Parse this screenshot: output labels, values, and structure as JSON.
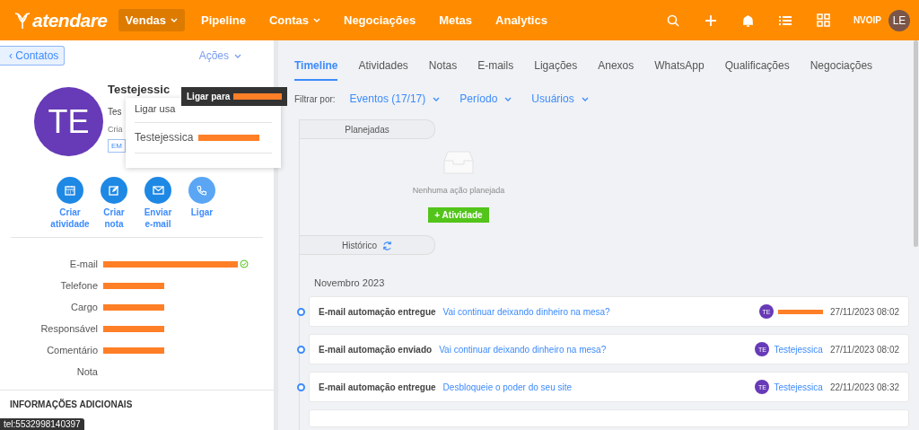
{
  "topbar": {
    "logo": "atendare",
    "nav": [
      {
        "label": "Vendas",
        "selected": true,
        "has_menu": true
      },
      {
        "label": "Pipeline",
        "selected": false,
        "has_menu": false
      },
      {
        "label": "Contas",
        "selected": false,
        "has_menu": true
      },
      {
        "label": "Negociações",
        "selected": false,
        "has_menu": false
      },
      {
        "label": "Metas",
        "selected": false,
        "has_menu": false
      },
      {
        "label": "Analytics",
        "selected": false,
        "has_menu": false
      }
    ],
    "account": "NVOIP",
    "avatar": "LE"
  },
  "contact": {
    "back": "‹ Contatos",
    "actions": "Ações",
    "avatar": "TE",
    "name": "Testejessic",
    "subtitle": "Tes",
    "created": "Cria",
    "tag": "EM",
    "quick_actions": [
      {
        "kind": "calendar",
        "label": "Criar atividade",
        "selected": false
      },
      {
        "kind": "note",
        "label": "Criar nota",
        "selected": false
      },
      {
        "kind": "mail",
        "label": "Enviar e-mail",
        "selected": false
      },
      {
        "kind": "phone",
        "label": "Ligar",
        "selected": true
      }
    ],
    "fields": [
      {
        "label": "E-mail",
        "redacted": true,
        "verified": true
      },
      {
        "label": "Telefone",
        "redacted": true,
        "verified": false
      },
      {
        "label": "Cargo",
        "redacted": true,
        "verified": false
      },
      {
        "label": "Responsável",
        "redacted": true,
        "verified": false
      },
      {
        "label": "Comentário",
        "redacted": true,
        "verified": false
      },
      {
        "label": "Nota",
        "redacted": false,
        "verified": false
      }
    ],
    "section": "INFORMAÇÕES ADICIONAIS"
  },
  "call_popover": {
    "option": "Ligar usa",
    "items": [
      {
        "name": "Testejessica",
        "redacted": true
      }
    ]
  },
  "tooltip": {
    "text": "Ligar para",
    "redacted": true
  },
  "tabs": [
    {
      "label": "Timeline",
      "selected": true
    },
    {
      "label": "Atividades",
      "selected": false
    },
    {
      "label": "Notas",
      "selected": false
    },
    {
      "label": "E-mails",
      "selected": false
    },
    {
      "label": "Ligações",
      "selected": false
    },
    {
      "label": "Anexos",
      "selected": false
    },
    {
      "label": "WhatsApp",
      "selected": false
    },
    {
      "label": "Qualificações",
      "selected": false
    },
    {
      "label": "Negociações",
      "selected": false
    }
  ],
  "filters": {
    "label": "Filtrar por:",
    "options": [
      "Eventos (17/17)",
      "Período",
      "Usuários"
    ]
  },
  "planned": {
    "title": "Planejadas",
    "empty": "Nenhuma ação planejada",
    "button": "+ Atividade"
  },
  "history": {
    "title": "Histórico",
    "month": "Novembro 2023",
    "events": [
      {
        "title": "E-mail automação entregue",
        "link": "Vai continuar deixando dinheiro na mesa?",
        "avatar": "TE",
        "redacted": true,
        "date": "27/11/2023 08:02"
      },
      {
        "title": "E-mail automação enviado",
        "link": "Vai continuar deixando dinheiro na mesa?",
        "avatar": "TE",
        "user": "Testejessica",
        "redacted": false,
        "date": "27/11/2023 08:02"
      },
      {
        "title": "E-mail automação entregue",
        "link": "Desbloqueie o poder do seu site",
        "avatar": "TE",
        "user": "Testejessica",
        "redacted": false,
        "date": "22/11/2023 08:32"
      }
    ]
  },
  "status_bar": {
    "text": "tel:5532998140397"
  }
}
